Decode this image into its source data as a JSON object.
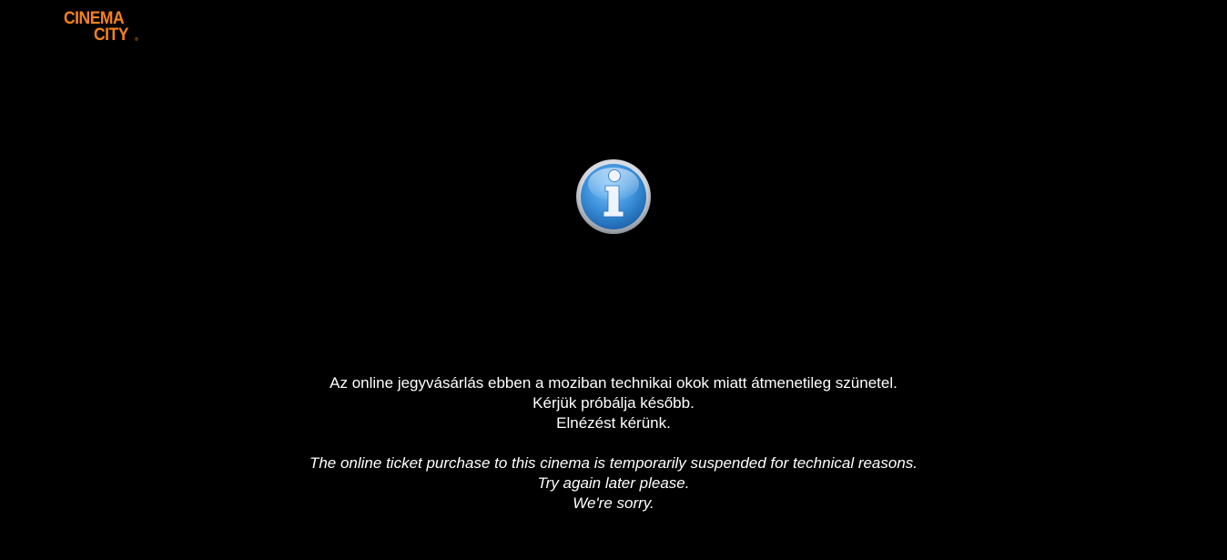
{
  "logo": {
    "line1": "CINEMA",
    "line2": "CITY",
    "trademark": "®",
    "color": "#f7821b"
  },
  "icon": {
    "name": "info-icon",
    "color": "#3a8fd9"
  },
  "message": {
    "hu": [
      "Az online jegyvásárlás ebben a moziban technikai okok miatt átmenetileg szünetel.",
      "Kérjük próbálja később.",
      "Elnézést kérünk."
    ],
    "en": [
      "The online ticket purchase to this cinema is temporarily suspended for technical reasons.",
      "Try again later please.",
      "We're sorry."
    ]
  }
}
